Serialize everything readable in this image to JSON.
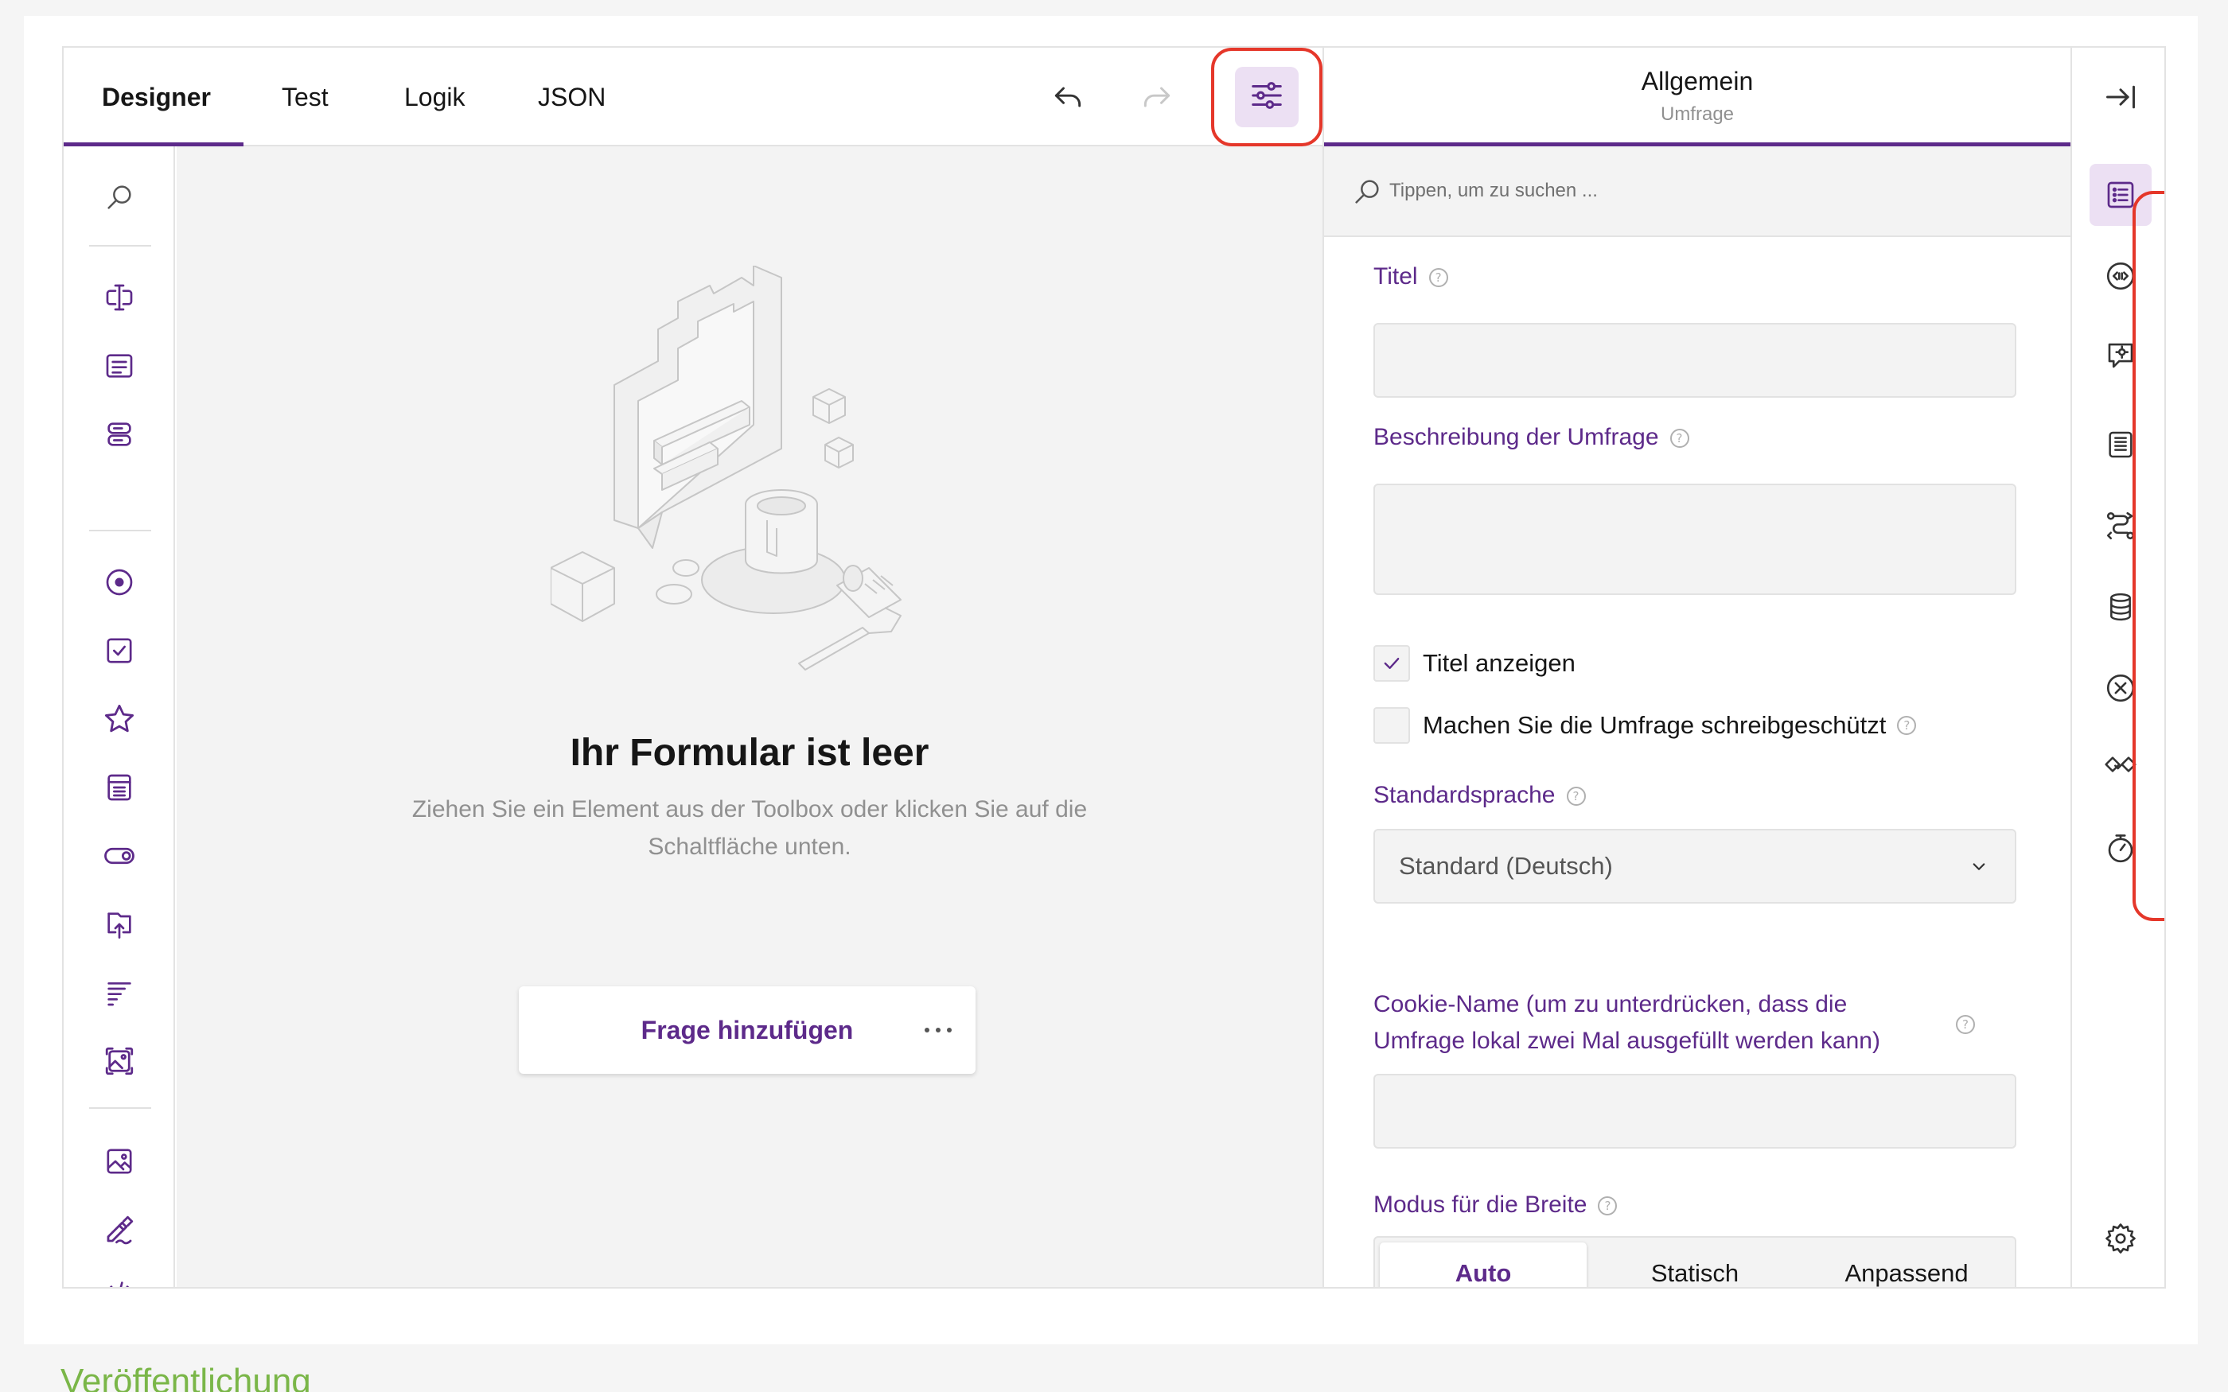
{
  "tabs": [
    {
      "label": "Designer",
      "active": true
    },
    {
      "label": "Test",
      "active": false
    },
    {
      "label": "Logik",
      "active": false
    },
    {
      "label": "JSON",
      "active": false
    }
  ],
  "toolbar": {
    "undo_icon": "undo-icon",
    "redo_icon": "redo-icon",
    "settings_icon": "sliders-icon"
  },
  "toolbox": {
    "items": [
      "search-icon",
      "single-input-icon",
      "comment-icon",
      "multiple-text-icon",
      "radio-group-icon",
      "checkbox-icon",
      "rating-icon",
      "dropdown-icon",
      "boolean-icon",
      "file-upload-icon",
      "ranking-icon",
      "image-picker-icon",
      "image-icon",
      "signature-pad-icon",
      "html-icon"
    ]
  },
  "canvas": {
    "title": "Ihr Formular ist leer",
    "description": "Ziehen Sie ein Element aus der Toolbox oder klicken Sie auf die Schaltfläche unten.",
    "add_button_label": "Frage hinzufügen",
    "more_label": "···"
  },
  "properties": {
    "header_title": "Allgemein",
    "header_subtitle": "Umfrage",
    "search_placeholder": "Tippen, um zu suchen ...",
    "title_label": "Titel",
    "title_value": "",
    "description_label": "Beschreibung der Umfrage",
    "description_value": "",
    "show_title_label": "Titel anzeigen",
    "show_title_checked": true,
    "readonly_label": "Machen Sie die Umfrage schreibgeschützt",
    "readonly_checked": false,
    "locale_label": "Standardsprache",
    "locale_value": "Standard (Deutsch)",
    "cookie_label_line1": "Cookie-Name (um zu unterdrücken, dass die",
    "cookie_label_line2": "Umfrage lokal zwei Mal ausgefüllt werden kann)",
    "cookie_value": "",
    "width_mode_label": "Modus für die Breite",
    "width_modes": [
      {
        "label": "Auto",
        "active": true
      },
      {
        "label": "Statisch",
        "active": false
      },
      {
        "label": "Anpassend",
        "active": false
      }
    ]
  },
  "rail": {
    "collapse_icon": "collapse-panel-icon",
    "items": [
      "general-list-icon",
      "logo-icon",
      "navigation-icon",
      "question-settings-icon",
      "conditions-icon",
      "data-icon",
      "validation-icon",
      "thank-you-icon",
      "timer-icon"
    ],
    "settings_icon": "gear-icon"
  },
  "footer": {
    "section_label": "Veröffentlichung"
  },
  "colors": {
    "accent": "#5d2a8a",
    "accent_bg": "#ece0f3",
    "highlight": "#e5372a",
    "link": "#7ab648"
  }
}
